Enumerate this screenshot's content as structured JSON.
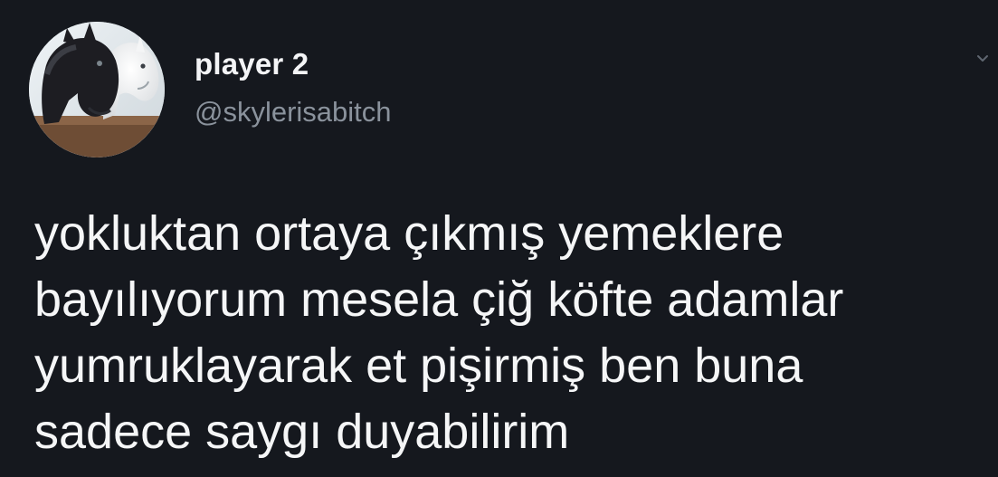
{
  "tweet": {
    "author": {
      "display_name": "player 2",
      "handle": "@skylerisabitch",
      "avatar_icon": "horse-avatar-icon"
    },
    "menu_icon": "chevron-down-icon",
    "text": "yokluktan ortaya çıkmış yemeklere\nbayılıyorum mesela çiğ köfte adamlar\nyumruklayarak et pişirmiş ben buna\nsadece saygı duyabilirim"
  },
  "colors": {
    "background": "#15181e",
    "primary_text": "#f5f6f7",
    "secondary_text": "#8a929c"
  }
}
